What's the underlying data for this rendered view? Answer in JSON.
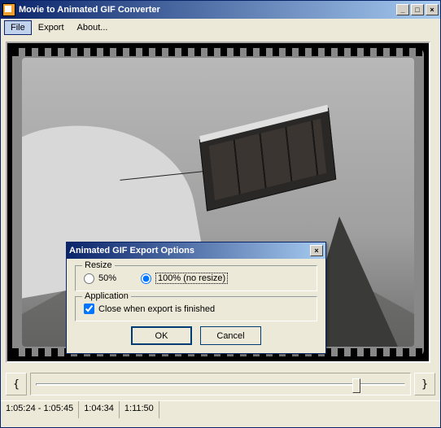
{
  "window": {
    "title": "Movie to Animated GIF Converter"
  },
  "menu": {
    "file": "File",
    "export": "Export",
    "about": "About..."
  },
  "dialog": {
    "title": "Animated GIF Export Options",
    "resize": {
      "legend": "Resize",
      "opt50": "50%",
      "opt100": "100% (no resize)"
    },
    "app": {
      "legend": "Application",
      "closeWhenFinished": "Close when export is finished"
    },
    "ok": "OK",
    "cancel": "Cancel"
  },
  "nav": {
    "prev": "{",
    "next": "}"
  },
  "status": {
    "range": "1:05:24 - 1:05:45",
    "pos": "1:04:34",
    "dur": "1:11:50"
  }
}
